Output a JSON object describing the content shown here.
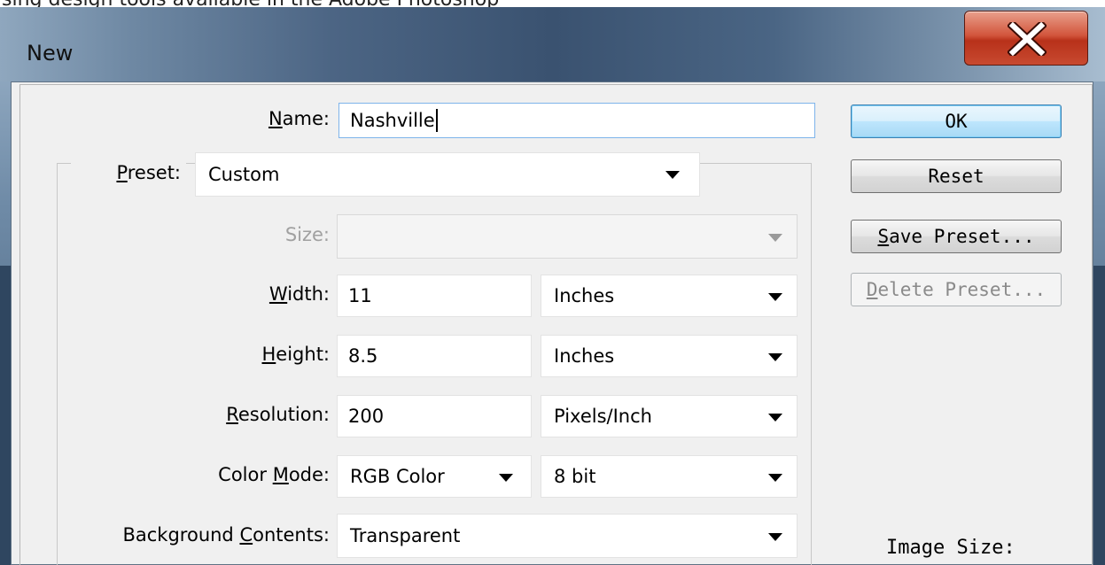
{
  "top_strip_text": "sing design tools available in the Adobe Photoshop",
  "window": {
    "title": "New"
  },
  "form": {
    "name_label_pre": "",
    "name_label_key": "N",
    "name_label_post": "ame:",
    "name_value": "Nashville",
    "preset_label_key": "P",
    "preset_label_post": "reset:",
    "preset_value": "Custom",
    "size_label": "Size:",
    "size_value": "",
    "width_label_key": "W",
    "width_label_post": "idth:",
    "width_value": "11",
    "width_unit": "Inches",
    "height_label_key": "H",
    "height_label_post": "eight:",
    "height_value": "8.5",
    "height_unit": "Inches",
    "resolution_label_key": "R",
    "resolution_label_post": "esolution:",
    "resolution_value": "200",
    "resolution_unit": "Pixels/Inch",
    "color_mode_label_pre": "Color ",
    "color_mode_label_key": "M",
    "color_mode_label_post": "ode:",
    "color_mode_value": "RGB Color",
    "bit_depth_value": "8 bit",
    "background_label_pre": "Background ",
    "background_label_key": "C",
    "background_label_post": "ontents:",
    "background_value": "Transparent"
  },
  "buttons": {
    "ok": "OK",
    "reset": "Reset",
    "save_preset_key": "S",
    "save_preset_post": "ave Preset...",
    "delete_preset_key": "D",
    "delete_preset_post": "elete Preset..."
  },
  "side_info": {
    "image_size_label": "Image Size:"
  },
  "colors": {
    "close_button": "#c8432a",
    "focus_border": "#7eb4ea",
    "default_button": "#3c7fb1"
  }
}
